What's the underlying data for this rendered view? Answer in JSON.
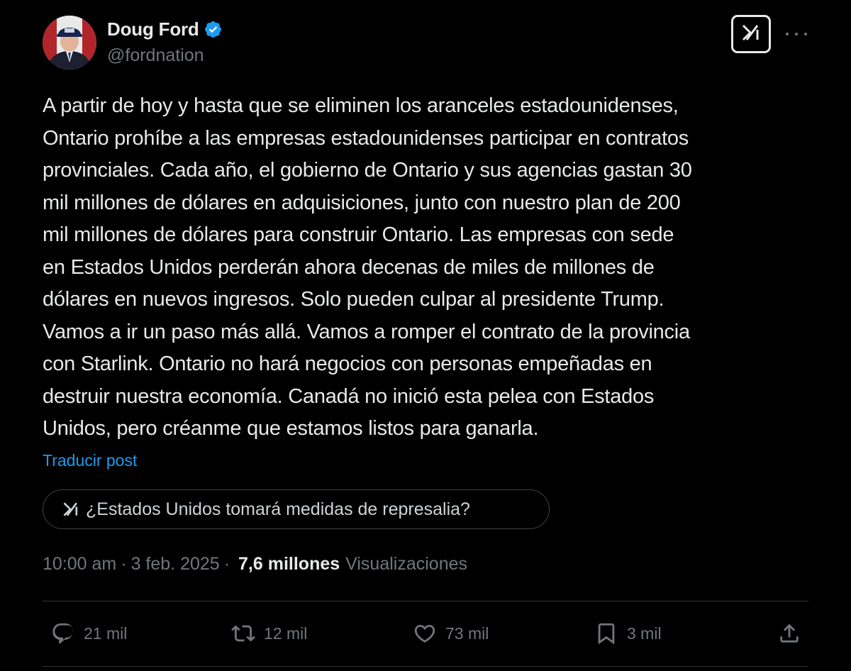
{
  "author": {
    "display_name": "Doug Ford",
    "handle": "@fordnation",
    "verified": true
  },
  "icons": {
    "verified": "verified-badge-icon",
    "grok": "grok-icon",
    "more": "more-dots-icon",
    "reply": "reply-icon",
    "repost": "repost-icon",
    "like": "heart-icon",
    "bookmark": "bookmark-icon",
    "share": "share-icon"
  },
  "colors": {
    "background": "#000000",
    "text": "#e7e9ea",
    "secondary": "#71767b",
    "link": "#1d9bf0",
    "verified": "#1d9bf0"
  },
  "post": {
    "text": "A partir de hoy y hasta que se eliminen los aranceles estadounidenses,\nOntario prohíbe a las empresas estadounidenses participar en contratos\nprovinciales. Cada año, el gobierno de Ontario y sus agencias gastan 30\nmil millones de dólares en adquisiciones, junto con nuestro plan de 200\nmil millones de dólares para construir Ontario. Las empresas con sede\nen Estados Unidos perderán ahora decenas de miles de millones de\ndólares en nuevos ingresos. Solo pueden culpar al presidente Trump.\nVamos a ir un paso más allá. Vamos a romper el contrato de la provincia\ncon Starlink. Ontario no hará negocios con personas empeñadas en\ndestruir nuestra economía. Canadá no inició esta pelea con Estados\nUnidos, pero créanme que estamos listos para ganarla.",
    "translate_label": "Traducir post"
  },
  "grok_prompt": "¿Estados Unidos tomará medidas de represalia?",
  "meta": {
    "time": "10:00 am",
    "separator": "·",
    "date": "3 feb. 2025",
    "views_count": "7,6 millones",
    "views_label": "Visualizaciones"
  },
  "actions": {
    "replies": "21 mil",
    "reposts": "12 mil",
    "likes": "73 mil",
    "bookmarks": "3 mil"
  }
}
